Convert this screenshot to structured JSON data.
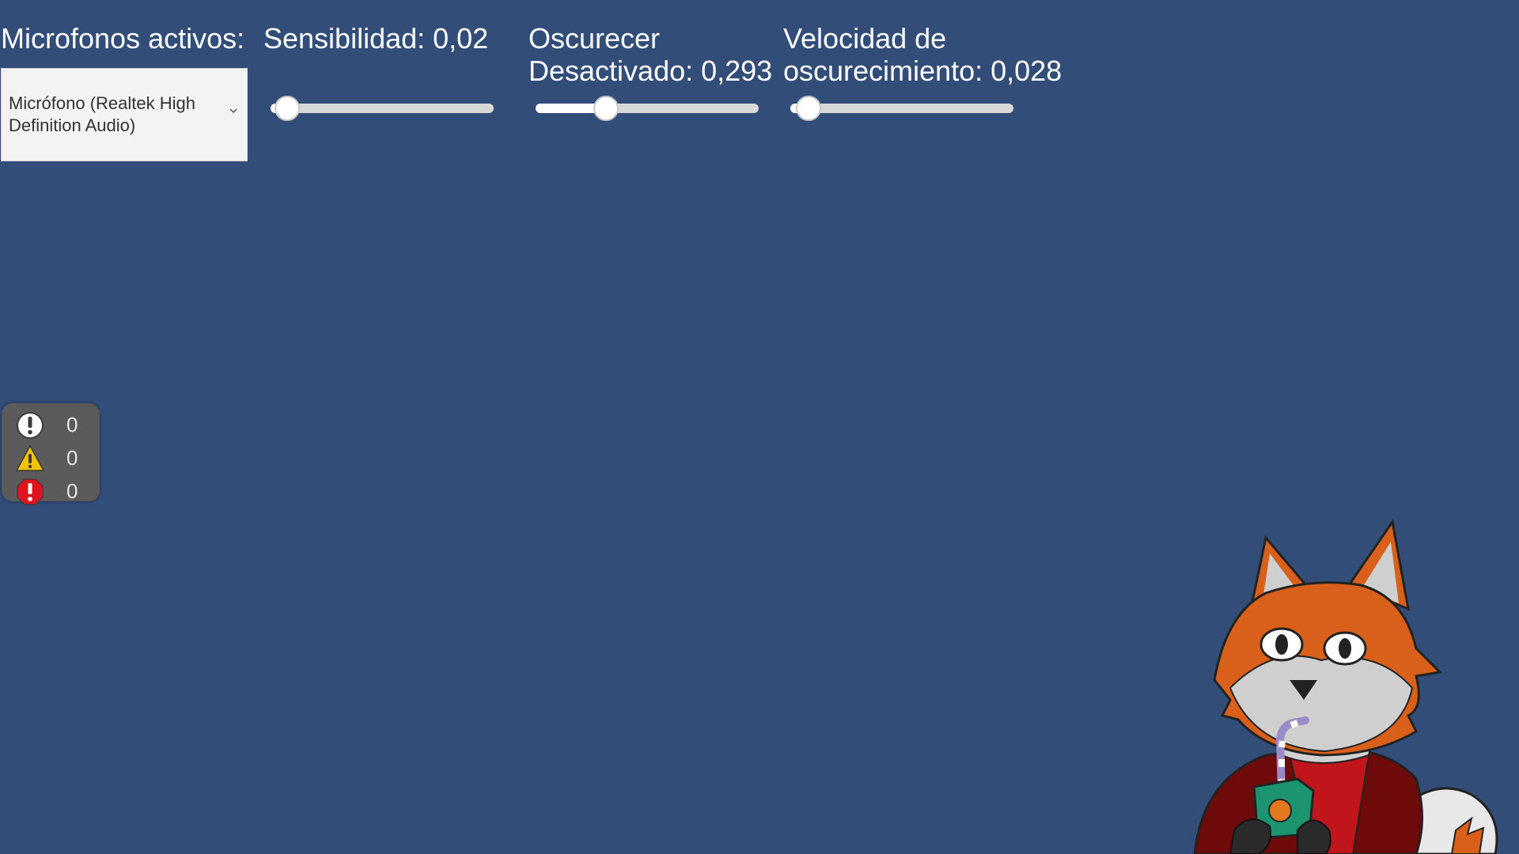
{
  "microphones": {
    "label": "Microfonos activos:",
    "selected": "Micrófono (Realtek High Definition Audio)"
  },
  "sensitivity": {
    "label": "Sensibilidad: 0,02",
    "value": 0.02
  },
  "darken_off": {
    "label_line1": "Oscurecer",
    "label_line2": "Desactivado: 0,293",
    "value": 0.293
  },
  "darken_speed": {
    "label_line1": "Velocidad de",
    "label_line2": "oscurecimiento: 0,028",
    "value": 0.028
  },
  "console": {
    "info_count": "0",
    "warning_count": "0",
    "error_count": "0"
  },
  "colors": {
    "background": "#314d78",
    "warning": "#f2c200",
    "error": "#e0141e"
  }
}
